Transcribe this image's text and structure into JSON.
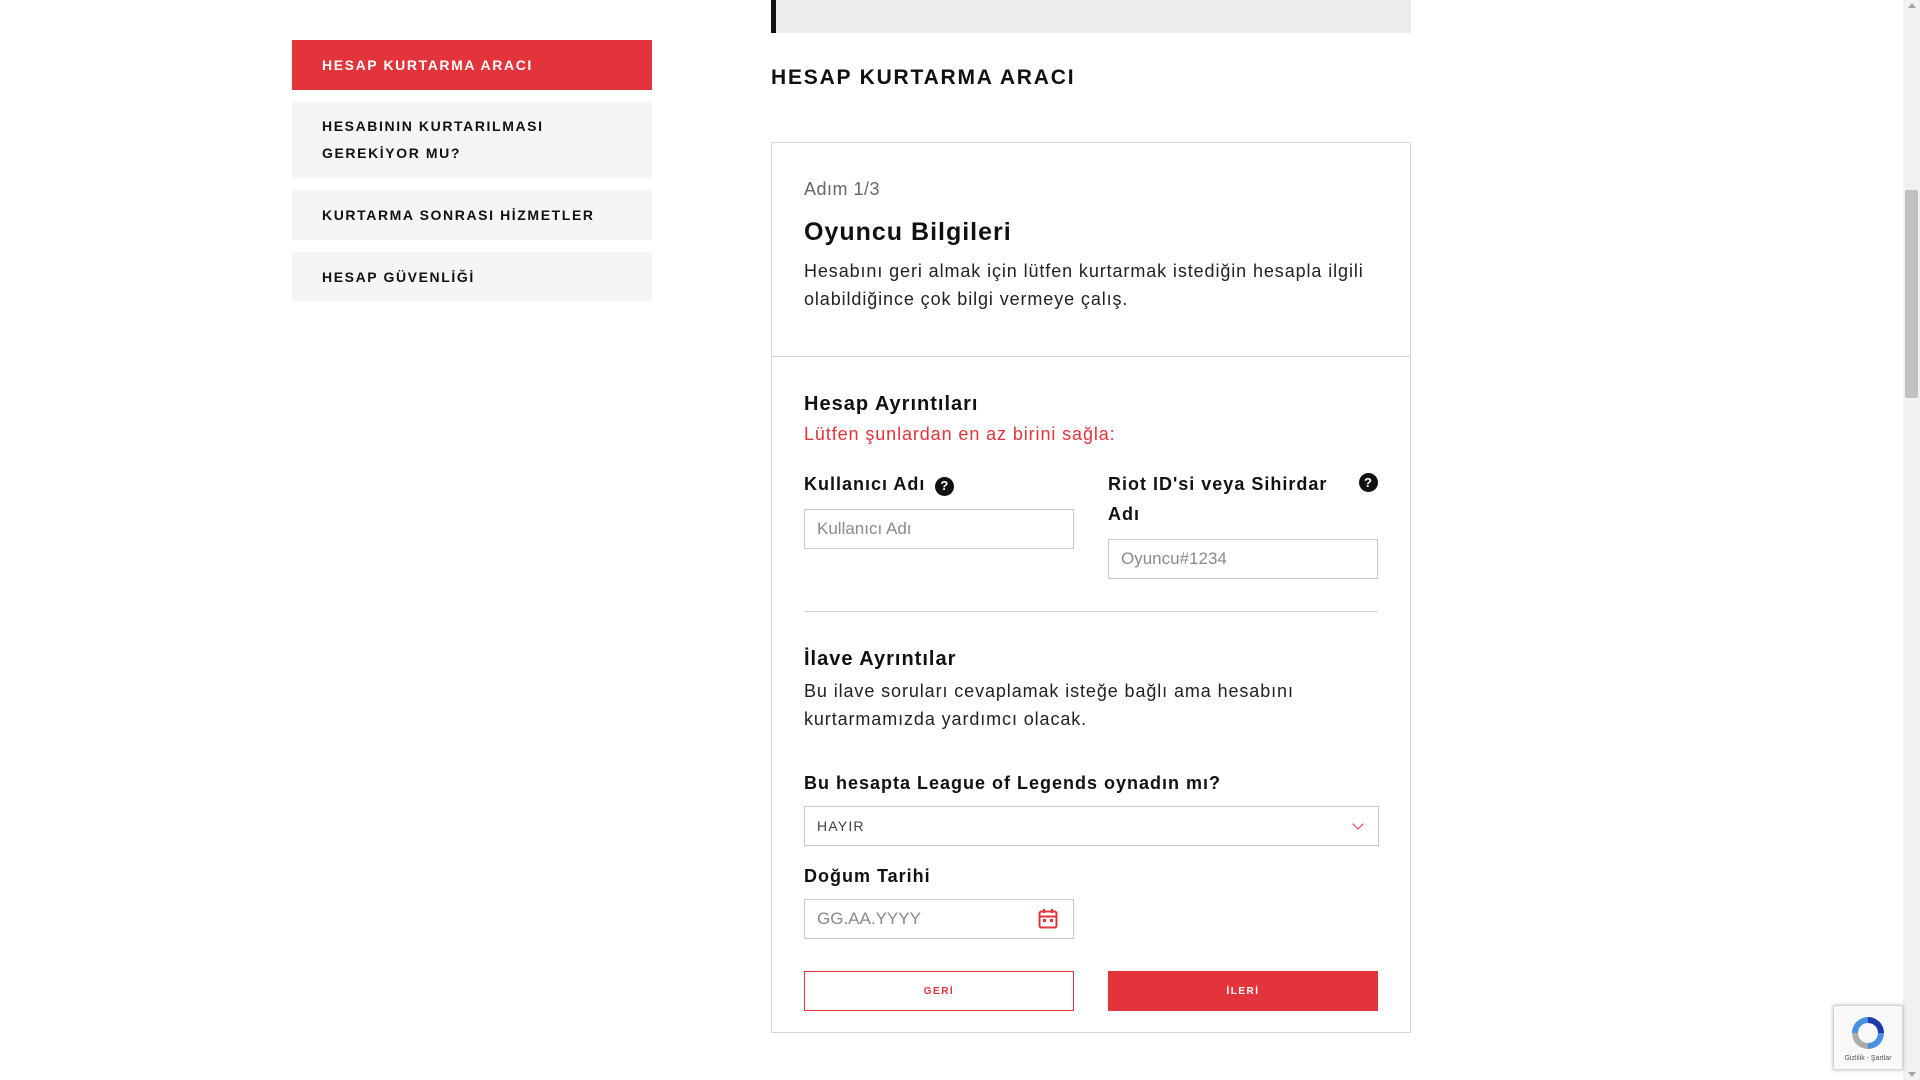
{
  "sidebar": {
    "items": [
      {
        "label": "HESAP KURTARMA ARACI"
      },
      {
        "label": "HESABININ KURTARILMASI GEREKİYOR MU?"
      },
      {
        "label": "KURTARMA SONRASI HİZMETLER"
      },
      {
        "label": "HESAP GÜVENLİĞİ"
      }
    ]
  },
  "main": {
    "title": "HESAP KURTARMA ARACI"
  },
  "form": {
    "step": "Adım 1/3",
    "heading": "Oyuncu Bilgileri",
    "description": "Hesabını geri almak için lütfen kurtarmak istediğin hesapla ilgili olabildiğince çok bilgi vermeye çalış.",
    "account_details": {
      "heading": "Hesap Ayrıntıları",
      "requirement": "Lütfen şunlardan en az birini sağla:",
      "username": {
        "label": "Kullanıcı Adı",
        "placeholder": "Kullanıcı Adı",
        "value": ""
      },
      "riot_id": {
        "label": "Riot ID'si veya Sihirdar Adı",
        "placeholder": "Oyuncu#1234",
        "value": ""
      }
    },
    "extra_details": {
      "heading": "İlave Ayrıntılar",
      "description": "Bu ilave soruları cevaplamak isteğe bağlı ama hesabını kurtarmamızda yardımcı olacak.",
      "lol_question": "Bu hesapta League of Legends oynadın mı?",
      "lol_selected": "HAYIR",
      "dob_label": "Doğum Tarihi",
      "dob_placeholder": "GG.AA.YYYY"
    },
    "back_label": "GERİ",
    "next_label": "İLERİ"
  },
  "recaptcha": {
    "links": "Gizlilik - Şartlar"
  },
  "colors": {
    "accent": "#e4343b",
    "text": "#111111",
    "panel": "#f5f5f5"
  }
}
